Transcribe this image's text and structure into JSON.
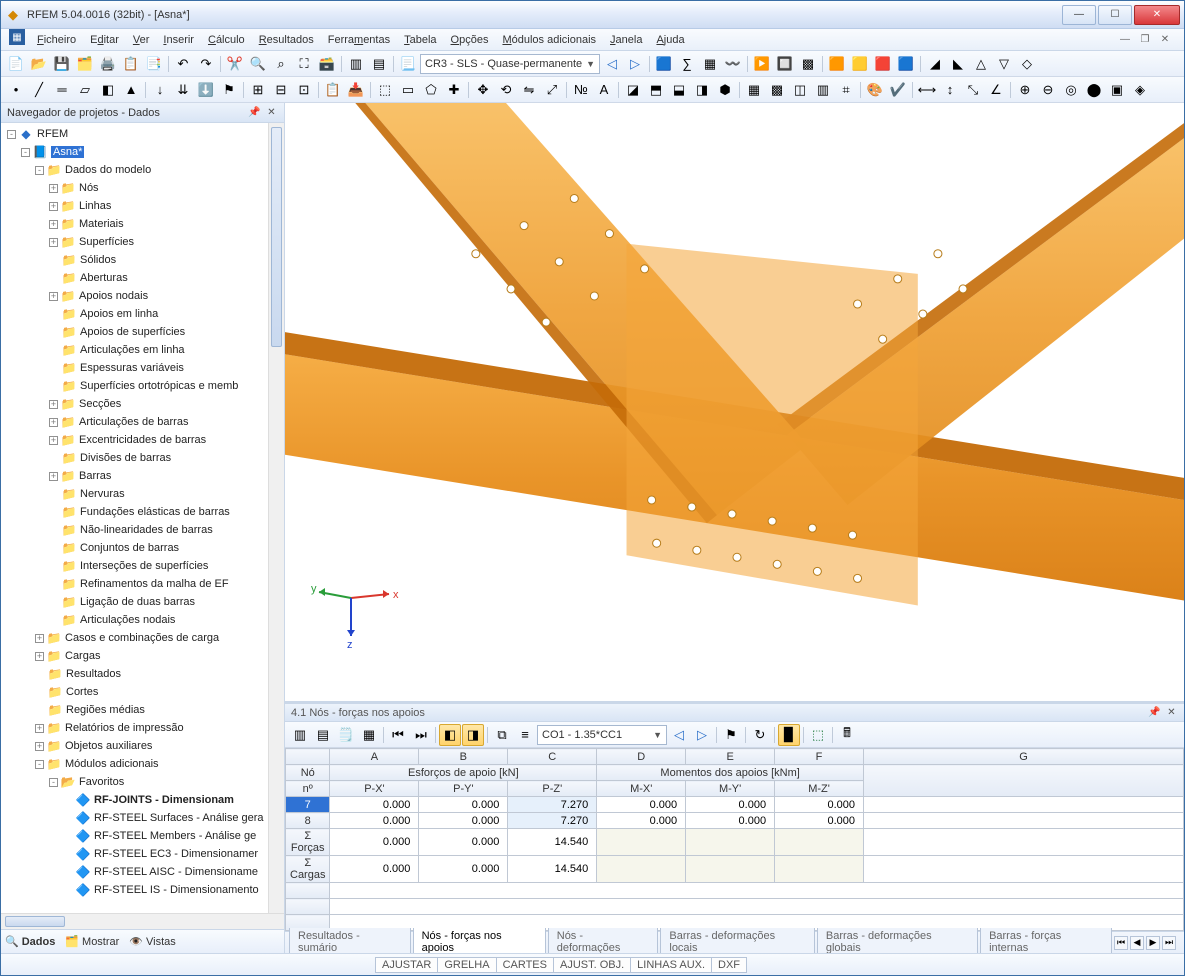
{
  "window": {
    "title": "RFEM 5.04.0016 (32bit) - [Asna*]"
  },
  "menu": [
    "Ficheiro",
    "Editar",
    "Ver",
    "Inserir",
    "Cálculo",
    "Resultados",
    "Ferramentas",
    "Tabela",
    "Opções",
    "Módulos adicionais",
    "Janela",
    "Ajuda"
  ],
  "toolbar1_combo": "CR3 - SLS - Quase-permanente",
  "navigator": {
    "title": "Navegador de projetos - Dados",
    "root": "RFEM",
    "project": "Asna*",
    "model_data": "Dados do modelo",
    "items": [
      "Nós",
      "Linhas",
      "Materiais",
      "Superfícies",
      "Sólidos",
      "Aberturas",
      "Apoios nodais",
      "Apoios em linha",
      "Apoios de superfícies",
      "Articulações em linha",
      "Espessuras variáveis",
      "Superfícies ortotrópicas e memb",
      "Secções",
      "Articulações de barras",
      "Excentricidades de barras",
      "Divisões de barras",
      "Barras",
      "Nervuras",
      "Fundações elásticas de barras",
      "Não-linearidades de barras",
      "Conjuntos de barras",
      "Interseções de superfícies",
      "Refinamentos da malha de EF",
      "Ligação de duas barras",
      "Articulações nodais"
    ],
    "folders2": [
      "Casos e combinações de carga",
      "Cargas",
      "Resultados",
      "Cortes",
      "Regiões médias",
      "Relatórios de impressão",
      "Objetos auxiliares",
      "Módulos adicionais"
    ],
    "favorites": "Favoritos",
    "fav_items": [
      "RF-JOINTS - Dimensionam",
      "RF-STEEL Surfaces - Análise gera",
      "RF-STEEL Members - Análise ge",
      "RF-STEEL EC3 - Dimensionamer",
      "RF-STEEL AISC - Dimensioname",
      "RF-STEEL IS - Dimensionamento"
    ],
    "tabs": [
      "Dados",
      "Mostrar",
      "Vistas"
    ]
  },
  "axes": {
    "x": "x",
    "y": "y",
    "z": "z"
  },
  "table": {
    "title": "4.1 Nós - forças nos apoios",
    "combo": "CO1 - 1.35*CC1",
    "cols_letters": [
      "A",
      "B",
      "C",
      "D",
      "E",
      "F",
      "G"
    ],
    "header_row1_left": "Nó",
    "header_row2_left": "nº",
    "group1": "Esforços de apoio [kN]",
    "group2": "Momentos dos apoios [kNm]",
    "subs": [
      "P-X'",
      "P-Y'",
      "P-Z'",
      "M-X'",
      "M-Y'",
      "M-Z'"
    ],
    "rows": [
      {
        "h": "7",
        "v": [
          "0.000",
          "0.000",
          "7.270",
          "0.000",
          "0.000",
          "0.000"
        ]
      },
      {
        "h": "8",
        "v": [
          "0.000",
          "0.000",
          "7.270",
          "0.000",
          "0.000",
          "0.000"
        ]
      },
      {
        "h": "Σ Forças",
        "v": [
          "0.000",
          "0.000",
          "14.540",
          "",
          "",
          ""
        ]
      },
      {
        "h": "Σ Cargas",
        "v": [
          "0.000",
          "0.000",
          "14.540",
          "",
          "",
          ""
        ]
      }
    ],
    "tabs": [
      "Resultados - sumário",
      "Nós - forças nos apoios",
      "Nós - deformações",
      "Barras - deformações locais",
      "Barras - deformações globais",
      "Barras - forças internas"
    ]
  },
  "status": [
    "AJUSTAR",
    "GRELHA",
    "CARTES",
    "AJUST. OBJ.",
    "LINHAS AUX.",
    "DXF"
  ]
}
